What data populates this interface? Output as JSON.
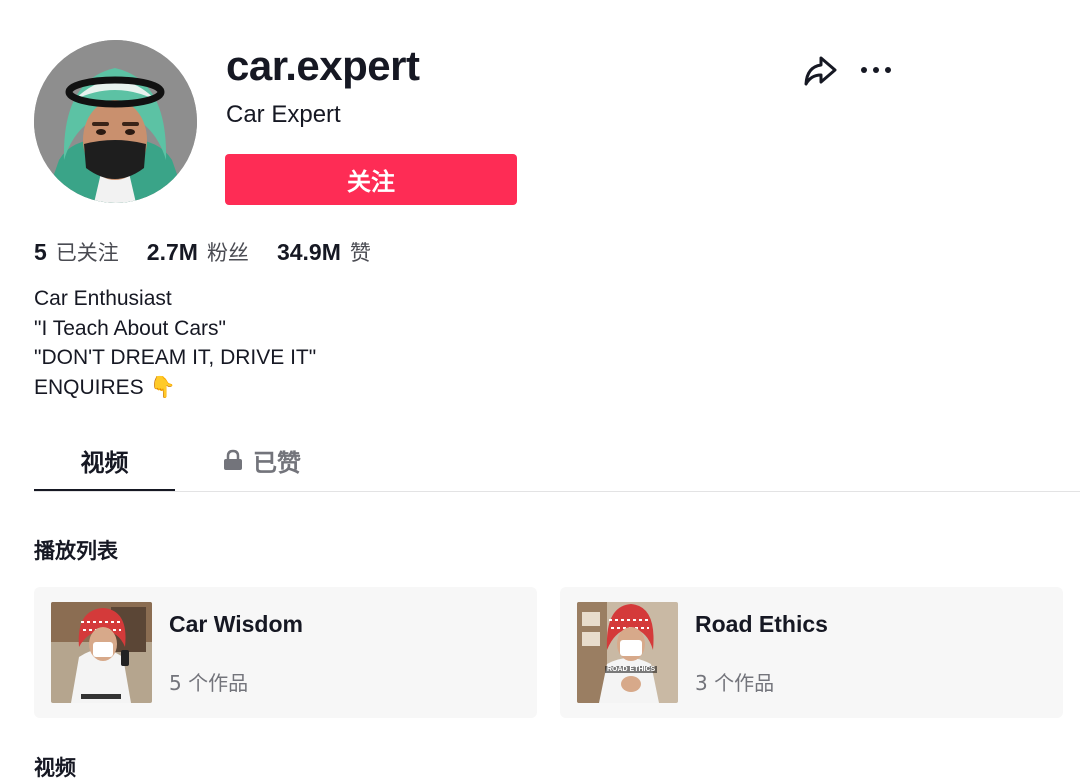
{
  "profile": {
    "username": "car.expert",
    "nickname": "Car Expert",
    "follow_label": "关注"
  },
  "actions": {
    "share_icon": "share-arrow-icon",
    "more_icon": "more-dots-icon"
  },
  "stats": [
    {
      "value": "5",
      "label": "已关注"
    },
    {
      "value": "2.7M",
      "label": "粉丝"
    },
    {
      "value": "34.9M",
      "label": "赞"
    }
  ],
  "bio": {
    "lines": [
      "Car Enthusiast",
      "\"I Teach About Cars\"",
      "\"DON'T DREAM IT, DRIVE IT\"",
      "ENQUIRES"
    ],
    "emoji": "👇"
  },
  "tabs": [
    {
      "label": "视频",
      "active": true
    },
    {
      "label": "已赞",
      "locked": true
    }
  ],
  "sections": {
    "playlists_title": "播放列表",
    "videos_title": "视频"
  },
  "playlists": [
    {
      "title": "Car Wisdom",
      "count": "5 个作品"
    },
    {
      "title": "Road Ethics",
      "count": "3 个作品",
      "thumb_caption": "ROAD ETHICS"
    }
  ],
  "colors": {
    "accent": "#fe2c55",
    "text": "#161823",
    "muted": "#73747b",
    "card_bg": "#f7f7f7"
  }
}
